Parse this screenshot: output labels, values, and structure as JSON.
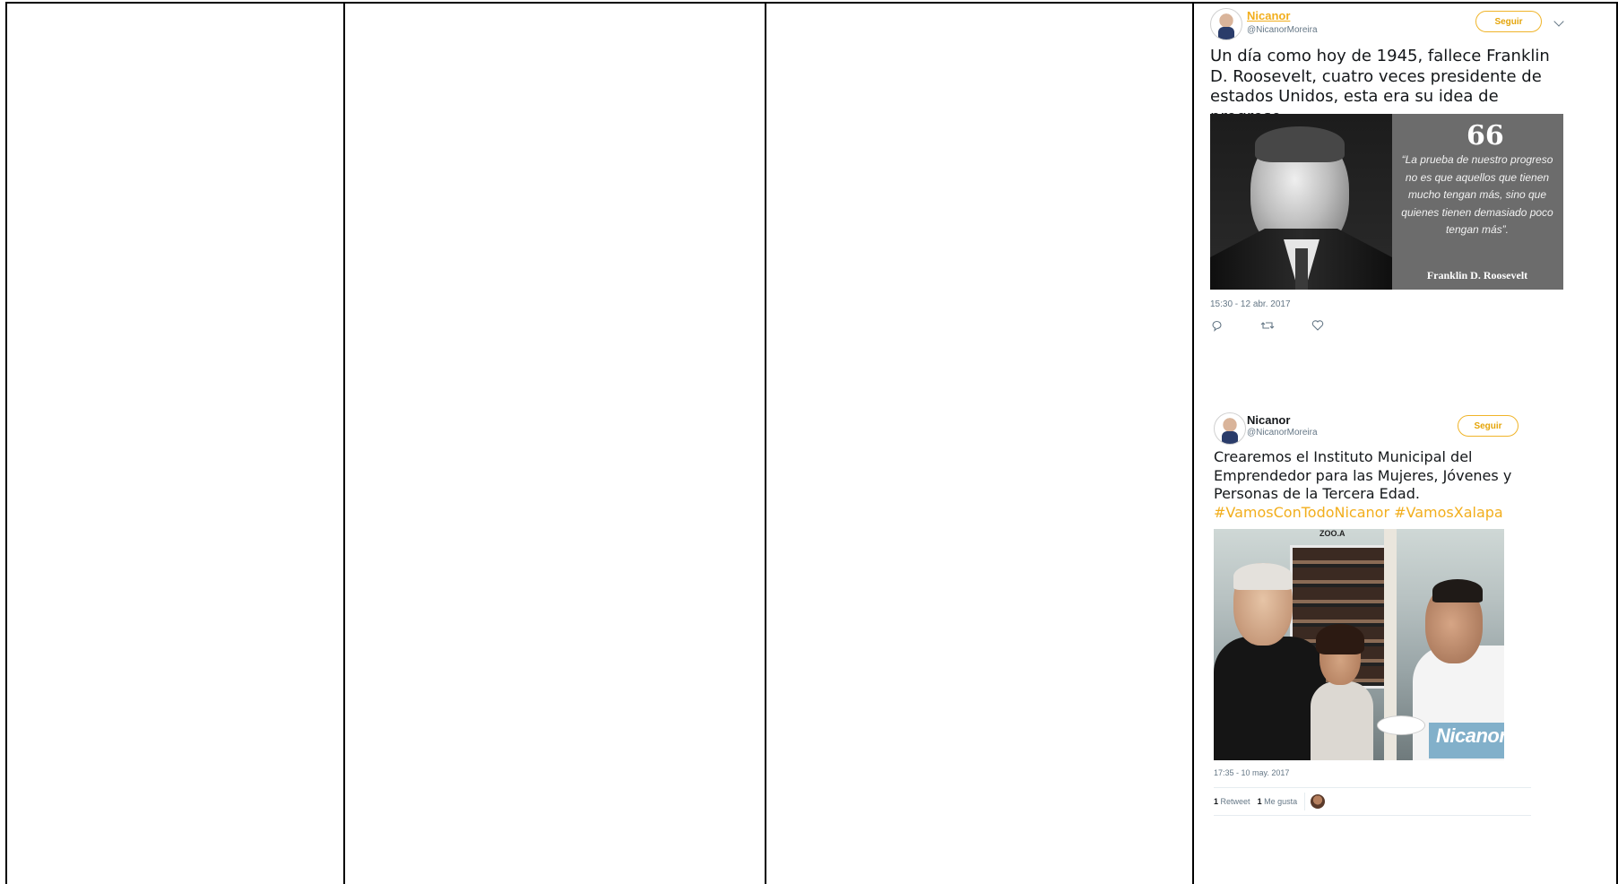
{
  "tweets": [
    {
      "name": "Nicanor",
      "handle": "@NicanorMoreira",
      "follow_label": "Seguir",
      "text": "Un día como hoy de 1945, fallece Franklin D. Roosevelt, cuatro veces presidente de estados Unidos, esta era su idea de progreso.",
      "card": {
        "quote_mark": "66",
        "quote": "“La prueba de nuestro progreso no es que aquellos que tienen mucho tengan más, sino que quienes tienen demasiado poco tengan más”.",
        "author": "Franklin D. Roosevelt"
      },
      "timestamp": "15:30 - 12 abr. 2017",
      "actions": [
        "reply-icon",
        "retweet-icon",
        "like-icon"
      ]
    },
    {
      "name": "Nicanor",
      "handle": "@NicanorMoreira",
      "follow_label": "Seguir",
      "text": "Crearemos el Instituto Municipal del Emprendedor para las Mujeres, Jóvenes y Personas de la Tercera Edad.",
      "hashtags": "#VamosConTodoNicanor #VamosXalapa",
      "photo": {
        "watermark": "Nicanor",
        "sign": "ZOO.A"
      },
      "timestamp": "17:35 - 10 may. 2017",
      "stats": {
        "retweets_count": "1",
        "retweets_label": "Retweet",
        "likes_count": "1",
        "likes_label": "Me gusta"
      }
    }
  ],
  "colors": {
    "accent": "#f2ae1c",
    "grid": "#000000"
  }
}
